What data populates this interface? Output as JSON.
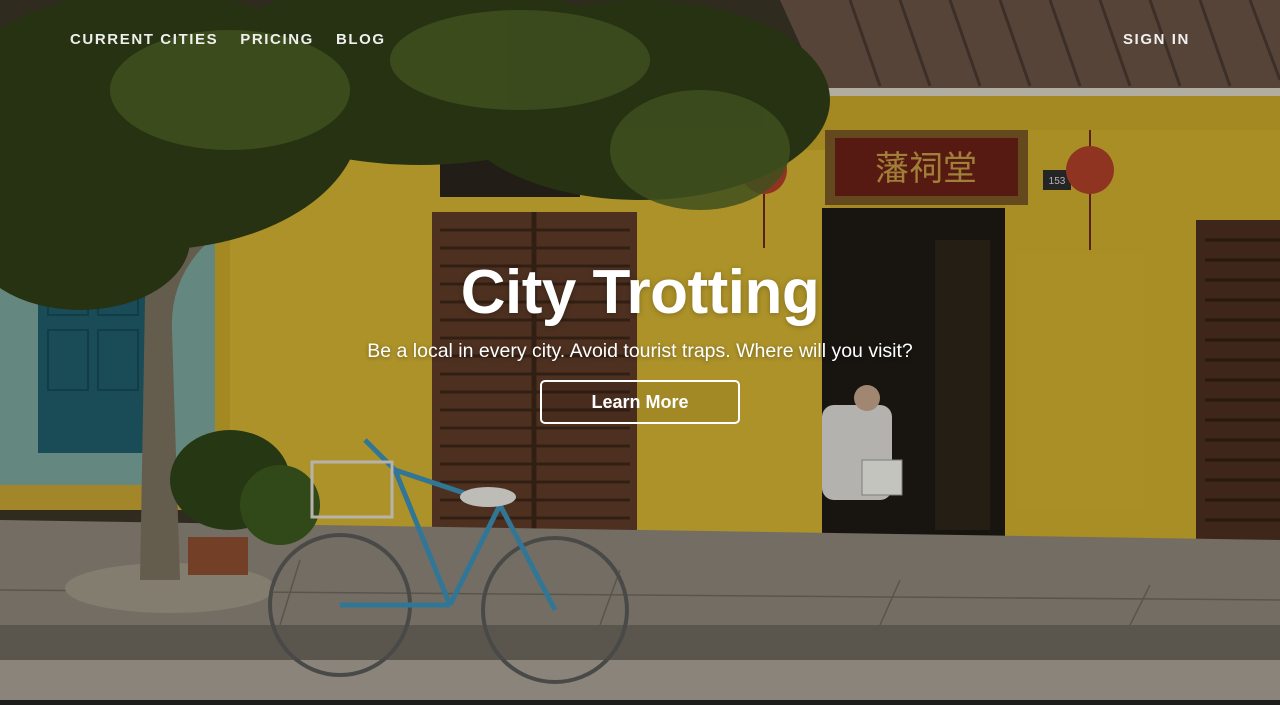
{
  "nav": {
    "items": [
      {
        "label": "CURRENT CITIES"
      },
      {
        "label": "PRICING"
      },
      {
        "label": "BLOG"
      }
    ],
    "sign_in": "SIGN IN"
  },
  "hero": {
    "title": "City Trotting",
    "tagline": "Be a local in every city. Avoid tourist traps. Where will you visit?",
    "cta": "Learn More"
  },
  "scene": {
    "sign_text": "藩祠堂",
    "house_number": "153"
  }
}
